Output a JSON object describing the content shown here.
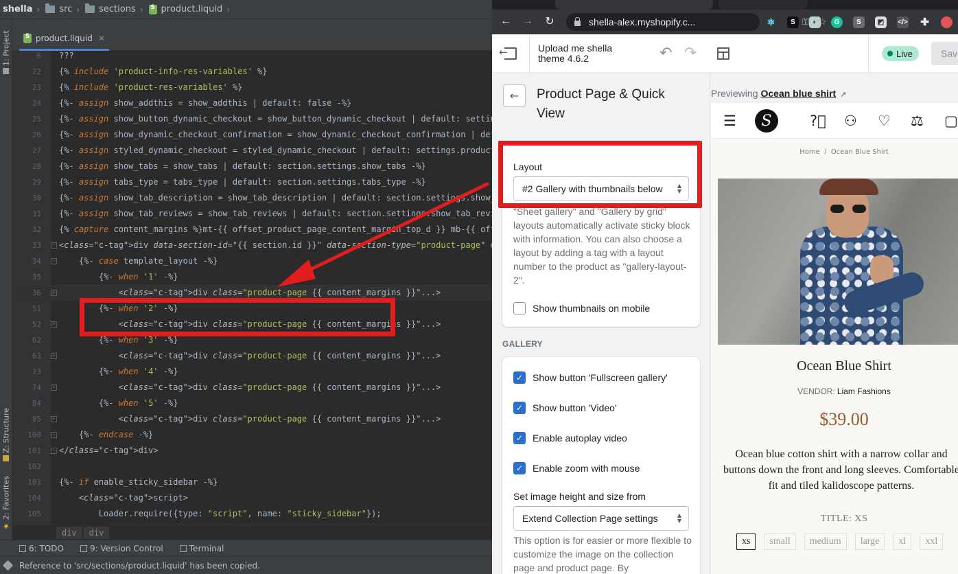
{
  "ide": {
    "breadcrumb": [
      "shella",
      "src",
      "sections",
      "product.liquid"
    ],
    "tab": {
      "label": "product.liquid"
    },
    "side_tabs": {
      "project": "1: Project",
      "structure": "Z: Structure",
      "favorites": "2: Favorites"
    },
    "lines": [
      {
        "n": "6",
        "text": "???"
      },
      {
        "n": "22",
        "text": "{% include 'product-info-res-variables' %}"
      },
      {
        "n": "23",
        "text": "{% include 'product-res-variables' %}"
      },
      {
        "n": "24",
        "text": "{%- assign show_addthis = show_addthis | default: false -%}"
      },
      {
        "n": "25",
        "text": "{%- assign show_button_dynamic_checkout = show_button_dynamic_checkout | default: settings"
      },
      {
        "n": "26",
        "text": "{%- assign show_dynamic_checkout_confirmation = show_dynamic_checkout_confirmation | defau"
      },
      {
        "n": "27",
        "text": "{%- assign styled_dynamic_checkout = styled_dynamic_checkout | default: settings.product_i"
      },
      {
        "n": "28",
        "text": "{%- assign show_tabs = show_tabs | default: section.settings.show_tabs -%}"
      },
      {
        "n": "29",
        "text": "{%- assign tabs_type = tabs_type | default: section.settings.tabs_type -%}"
      },
      {
        "n": "30",
        "text": "{%- assign show_tab_description = show_tab_description | default: section.settings.show_ta"
      },
      {
        "n": "31",
        "text": "{%- assign show_tab_reviews = show_tab_reviews | default: section.settings.show_tab_review"
      },
      {
        "n": "32",
        "text": "{% capture content_margins %}mt-{{ offset_product_page_content_margin_top_d }} mb-{{ offse"
      },
      {
        "n": "33",
        "text": "<div data-section-id=\"{{ section.id }}\" data-section-type=\"product-page\" data-enable-histo"
      },
      {
        "n": "34",
        "text": "    {%- case template_layout -%}"
      },
      {
        "n": "35",
        "text": "        {%- when '1' -%}"
      },
      {
        "n": "36",
        "text": "            <div class=\"product-page {{ content_margins }}\"...>"
      },
      {
        "n": "51",
        "text": "        {%- when '2' -%}"
      },
      {
        "n": "52",
        "text": "            <div class=\"product-page {{ content_margins }}\"...>"
      },
      {
        "n": "62",
        "text": "        {%- when '3' -%}"
      },
      {
        "n": "63",
        "text": "            <div class=\"product-page {{ content_margins }}\"...>"
      },
      {
        "n": "73",
        "text": "        {%- when '4' -%}"
      },
      {
        "n": "74",
        "text": "            <div class=\"product-page {{ content_margins }}\"...>"
      },
      {
        "n": "84",
        "text": "        {%- when '5' -%}"
      },
      {
        "n": "85",
        "text": "            <div class=\"product-page {{ content_margins }}\"...>"
      },
      {
        "n": "100",
        "text": "    {%- endcase -%}"
      },
      {
        "n": "101",
        "text": "</div>"
      },
      {
        "n": "102",
        "text": ""
      },
      {
        "n": "103",
        "text": "{%- if enable_sticky_sidebar -%}"
      },
      {
        "n": "104",
        "text": "    <script>"
      },
      {
        "n": "105",
        "text": "        Loader.require({type: \"script\", name: \"sticky_sidebar\"});"
      }
    ],
    "editor_breadcrumb": [
      "div",
      "div"
    ],
    "tool_windows": {
      "todo": "6: TODO",
      "vcs": "9: Version Control",
      "terminal": "Terminal"
    },
    "status": "Reference to 'src/sections/product.liquid' has been copied."
  },
  "browser": {
    "url": "shella-alex.myshopify.c..."
  },
  "theme": {
    "name_line1": "Upload me shella",
    "name_line2": "theme 4.6.2",
    "live": "Live",
    "save": "Save"
  },
  "panel": {
    "title": "Product Page & Quick View",
    "layout": {
      "label": "Layout",
      "value": "#2 Gallery with thumbnails below",
      "help": "\"Sheet gallery\" and \"Gallery by grid\" layouts automatically activate sticky block with information. You can also choose a layout by adding a tag with a layout number to the product as \"gallery-layout-2\"."
    },
    "show_thumbnails_mobile": "Show thumbnails on mobile",
    "gallery_heading": "GALLERY",
    "gallery_options": [
      {
        "label": "Show button 'Fullscreen gallery'",
        "checked": true
      },
      {
        "label": "Show button 'Video'",
        "checked": true
      },
      {
        "label": "Enable autoplay video",
        "checked": true
      },
      {
        "label": "Enable zoom with mouse",
        "checked": true
      }
    ],
    "image_size": {
      "label": "Set image height and size from",
      "value": "Extend Collection Page settings",
      "help": "This option is for easier or more flexible to customize the image on the collection page and product page. By"
    }
  },
  "preview": {
    "previewing_label": "Previewing",
    "previewing_product": "Ocean blue shirt",
    "breadcrumb_home": "Home",
    "breadcrumb_sep": "/",
    "breadcrumb_current": "Ocean Blue Shirt",
    "product_title": "Ocean Blue Shirt",
    "vendor_label": "VENDOR:",
    "vendor_name": "Liam Fashions",
    "price": "$39.00",
    "description": "Ocean blue cotton shirt with a narrow collar and buttons down the front and long sleeves. Comfortable fit and tiled kalidoscope patterns.",
    "option_title": "TITLE: XS",
    "sizes": [
      "xs",
      "small",
      "medium",
      "large",
      "xl",
      "xxl"
    ],
    "selected_size": "xs"
  }
}
